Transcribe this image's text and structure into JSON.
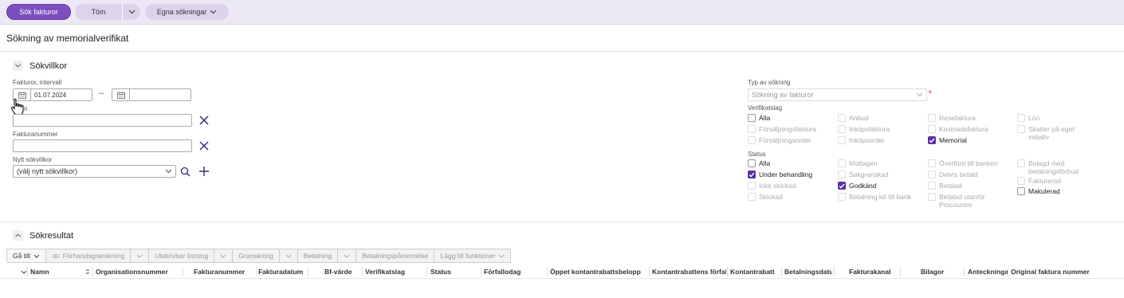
{
  "toolbar": {
    "search_label": "Sök fakturor",
    "clear_label": "Töm",
    "saved_searches_label": "Egna sökningar"
  },
  "page": {
    "title": "Sökning av memorialverifikat"
  },
  "criteria": {
    "section_title": "Sökvillkor",
    "interval_label": "Fakturor, intervall",
    "date_from": "01.07.2024",
    "date_to": "",
    "dash": "–",
    "field2_label": "n",
    "field2_value": "",
    "invoice_number_label": "Fakturanummer",
    "invoice_number_value": "",
    "new_condition_label": "Nytt sökvillkor",
    "new_condition_value": "(välj nytt sökvillkor)"
  },
  "search_type": {
    "label": "Typ av sökning",
    "value": "Sökning av fakturor",
    "required_mark": "*"
  },
  "verifikatslag": {
    "label": "Verifikatslag",
    "items": [
      {
        "label": "Alla",
        "checked": false,
        "enabled": true
      },
      {
        "label": "Anbud",
        "checked": false,
        "enabled": false
      },
      {
        "label": "Resefaktura",
        "checked": false,
        "enabled": false
      },
      {
        "label": "Lön",
        "checked": false,
        "enabled": false
      },
      {
        "label": "Försäljningsfaktura",
        "checked": false,
        "enabled": false
      },
      {
        "label": "Inköpsfaktura",
        "checked": false,
        "enabled": false
      },
      {
        "label": "Kostnadsfaktura",
        "checked": false,
        "enabled": false
      },
      {
        "label": "Skatter på eget initiativ",
        "checked": false,
        "enabled": false
      },
      {
        "label": "Försäljningsorder",
        "checked": false,
        "enabled": false
      },
      {
        "label": "Inköpsorder",
        "checked": false,
        "enabled": false
      },
      {
        "label": "Memorial",
        "checked": true,
        "enabled": true
      }
    ]
  },
  "status": {
    "label": "Status",
    "items": [
      {
        "label": "Alla",
        "checked": false,
        "enabled": true
      },
      {
        "label": "Mottagen",
        "checked": false,
        "enabled": false
      },
      {
        "label": "Överförd till banken",
        "checked": false,
        "enabled": false
      },
      {
        "label": "Belagd med betalningsförbud",
        "checked": false,
        "enabled": false
      },
      {
        "label": "Under behandling",
        "checked": true,
        "enabled": true
      },
      {
        "label": "Sakgranskad",
        "checked": false,
        "enabled": false
      },
      {
        "label": "Delvis betald",
        "checked": false,
        "enabled": false
      },
      {
        "label": "Fakturerad",
        "checked": false,
        "enabled": false
      },
      {
        "label": "Icke skickad",
        "checked": false,
        "enabled": false
      },
      {
        "label": "Godkänd",
        "checked": true,
        "enabled": true
      },
      {
        "label": "Betalad",
        "checked": false,
        "enabled": false
      },
      {
        "label": "Makulerad",
        "checked": false,
        "enabled": true
      },
      {
        "label": "Skickad",
        "checked": false,
        "enabled": false
      },
      {
        "label": "Betalning kö till bank",
        "checked": false,
        "enabled": false
      },
      {
        "label": "Betalad utanför Procountor",
        "checked": false,
        "enabled": false
      }
    ]
  },
  "results": {
    "section_title": "Sökresultat",
    "buttons": [
      {
        "label": "Gå till",
        "enabled": true
      },
      {
        "label": "Förhandsgranskning",
        "enabled": false
      },
      {
        "label": "Utskrivbar listning",
        "enabled": false
      },
      {
        "label": "Granskning",
        "enabled": false
      },
      {
        "label": "Betalning",
        "enabled": false
      },
      {
        "label": "Betalningspåminnelse",
        "enabled": false
      },
      {
        "label": "Lägg till funktioner",
        "enabled": false
      }
    ],
    "columns": [
      "Namn",
      "Organisationsnummer",
      "Fakturanummer",
      "Fakturadatum",
      "Bf-värde",
      "Verifikatslag",
      "Status",
      "Förfallodag",
      "Öppet kontantrabattsbelopp",
      "Kontantrabattens förfallodag",
      "Kontantrabatt",
      "Betalningsdatum",
      "Fakturakanal",
      "Bilagor",
      "Anteckningar",
      "Original faktura nummer"
    ]
  },
  "colors": {
    "accent": "#7b4fbf",
    "checkbox_on": "#5a2ea6",
    "remove_icon": "#3a2a7a"
  }
}
